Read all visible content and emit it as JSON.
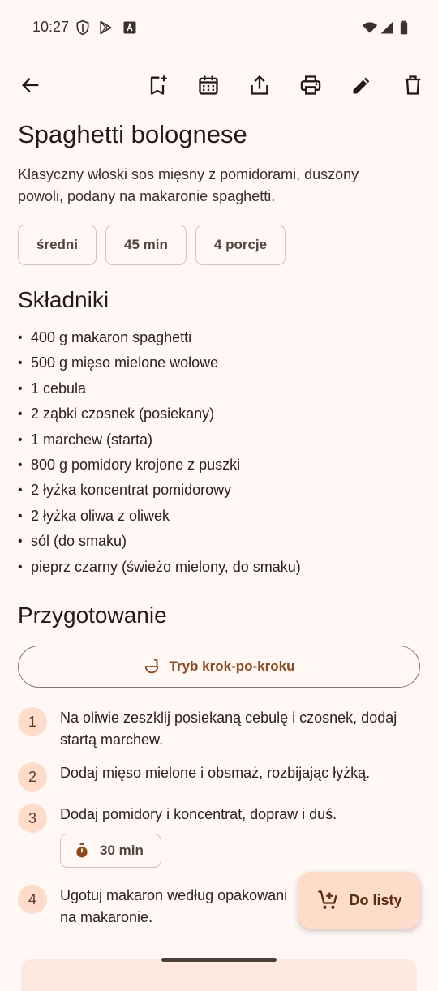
{
  "status_bar": {
    "time": "10:27",
    "icons": [
      "shield-icon",
      "play-store-icon",
      "font-icon",
      "wifi-icon",
      "signal-icon",
      "battery-icon"
    ]
  },
  "toolbar": {
    "icons": [
      "back-arrow-icon",
      "bookmark-add-icon",
      "calendar-icon",
      "share-icon",
      "print-icon",
      "edit-icon",
      "delete-icon"
    ]
  },
  "recipe": {
    "title": "Spaghetti bolognese",
    "description": "Klasyczny włoski sos mięsny z pomidorami, duszony powoli, podany na makaronie spaghetti.",
    "chips": [
      "średni",
      "45 min",
      "4 porcje"
    ]
  },
  "ingredients": {
    "title": "Składniki",
    "bullet": "•",
    "items": [
      "400 g makaron spaghetti",
      "500 g mięso mielone wołowe",
      "1 cebula",
      "2 ząbki czosnek (posiekany)",
      "1 marchew (starta)",
      "800 g pomidory krojone z puszki",
      "2 łyżka koncentrat pomidorowy",
      "2 łyżka oliwa z oliwek",
      "sól (do smaku)",
      "pieprz czarny (świeżo mielony, do smaku)"
    ]
  },
  "preparation": {
    "title": "Przygotowanie",
    "step_mode_label": "Tryb krok-po-kroku",
    "steps": [
      {
        "number": "1",
        "text": "Na oliwie zeszklij posiekaną cebulę i czosnek, dodaj startą marchew."
      },
      {
        "number": "2",
        "text": "Dodaj mięso mielone i obsmaż, rozbijając łyżką."
      },
      {
        "number": "3",
        "text": "Dodaj pomidory i koncentrat, dopraw i duś."
      },
      {
        "number": "4",
        "text": "Ugotuj makaron według opakowani"
      },
      {
        "number": "",
        "text": "na makaronie."
      }
    ],
    "timer_label": "30 min"
  },
  "fab": {
    "label": "Do listy",
    "icon": "cart-add-icon"
  },
  "colors": {
    "background": "#FFF8F5",
    "accent": "#8B4A1E",
    "step_badge": "#FFDBCA",
    "fab": "#FFDBCA"
  }
}
